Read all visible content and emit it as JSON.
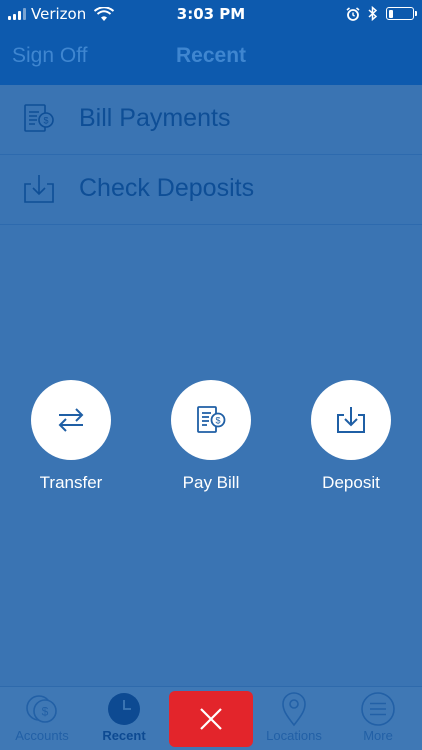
{
  "status_bar": {
    "carrier": "Verizon",
    "time": "3:03 PM",
    "battery_level": 0.2
  },
  "nav": {
    "left_button": "Sign Off",
    "title": "Recent"
  },
  "recent_list": [
    {
      "label": "Bill Payments",
      "icon": "bill-icon"
    },
    {
      "label": "Check Deposits",
      "icon": "deposit-icon"
    }
  ],
  "actions": [
    {
      "label": "Transfer",
      "icon": "transfer-icon"
    },
    {
      "label": "Pay Bill",
      "icon": "bill-icon"
    },
    {
      "label": "Deposit",
      "icon": "deposit-icon"
    }
  ],
  "tab_bar": {
    "tabs": [
      {
        "label": "Accounts",
        "icon": "accounts-icon"
      },
      {
        "label": "Recent",
        "icon": "clock-icon",
        "active": true
      },
      {
        "label": "Locations",
        "icon": "location-pin-icon"
      },
      {
        "label": "More",
        "icon": "menu-icon"
      }
    ],
    "close_icon": "close-icon"
  },
  "colors": {
    "overlay": "#3a74b3",
    "header": "#0d5aae",
    "close_button": "#e3252b",
    "list_text": "#0e4e96",
    "white": "#ffffff"
  }
}
